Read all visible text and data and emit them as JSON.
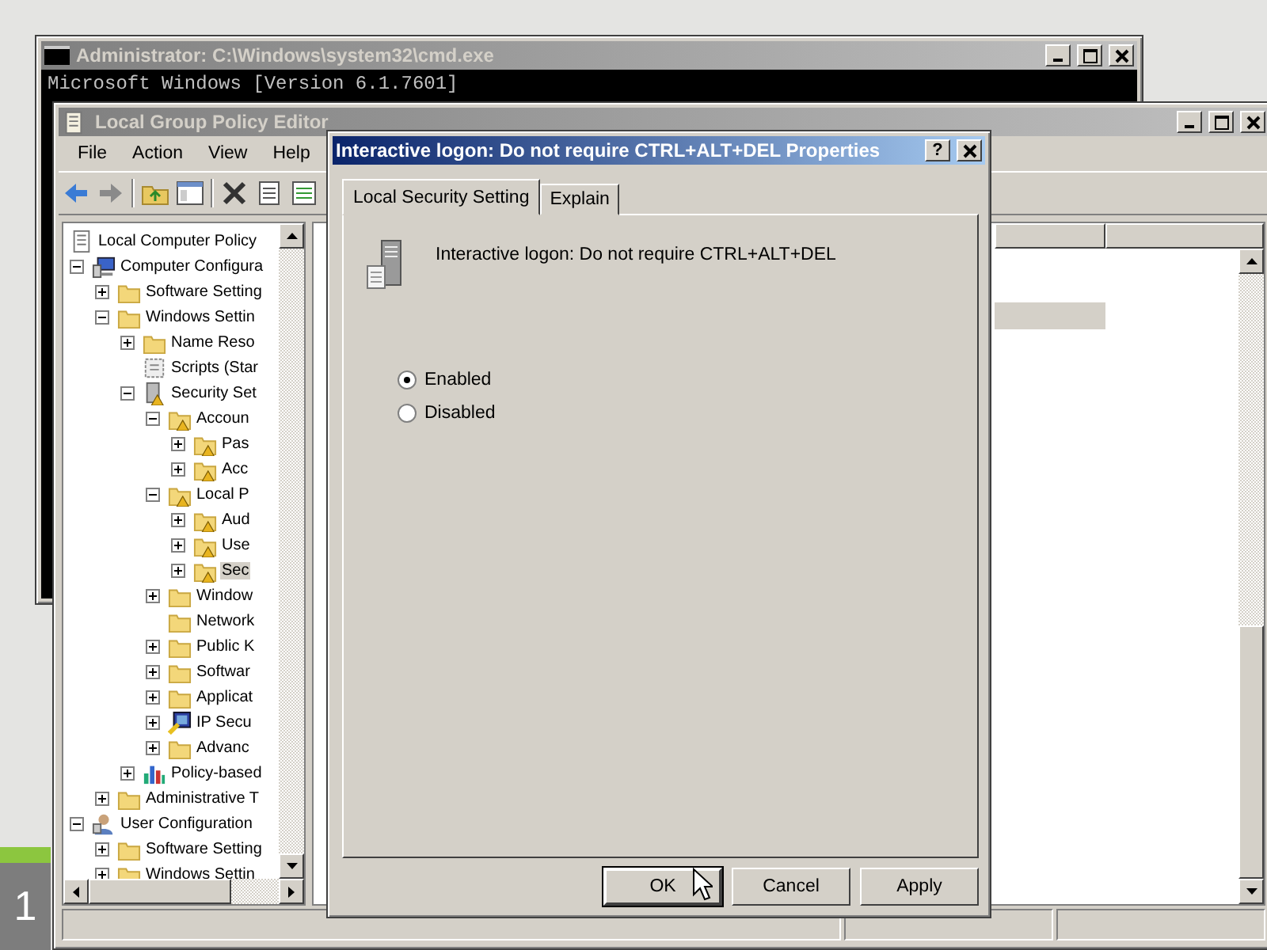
{
  "desktop": {
    "label": "1"
  },
  "console_window": {
    "title": "Administrator: C:\\Windows\\system32\\cmd.exe",
    "lines": [
      "Microsoft Windows [Version 6.1.7601]"
    ]
  },
  "editor_window": {
    "title": "Local Group Policy Editor",
    "menu": [
      "File",
      "Action",
      "View",
      "Help"
    ],
    "tree": [
      {
        "label": "Local Computer Policy",
        "kind": "policy",
        "selected": false,
        "children": [
          {
            "label": "Computer Configura",
            "kind": "computer",
            "expanded": true,
            "selected": false,
            "children": [
              {
                "label": "Software Setting",
                "kind": "folder",
                "expanded": false,
                "selected": false
              },
              {
                "label": "Windows Settin",
                "kind": "folder",
                "expanded": true,
                "selected": false,
                "children": [
                  {
                    "label": "Name Reso",
                    "kind": "folder",
                    "expanded": false,
                    "selected": false
                  },
                  {
                    "label": "Scripts (Star",
                    "kind": "script",
                    "selected": false
                  },
                  {
                    "label": "Security Set",
                    "kind": "security",
                    "expanded": true,
                    "selected": false,
                    "children": [
                      {
                        "label": "Accoun",
                        "kind": "lockfolder",
                        "expanded": true,
                        "selected": false,
                        "children": [
                          {
                            "label": "Pas",
                            "kind": "lockfolder",
                            "expanded": false,
                            "selected": false
                          },
                          {
                            "label": "Acc",
                            "kind": "lockfolder",
                            "expanded": false,
                            "selected": false
                          }
                        ]
                      },
                      {
                        "label": "Local P",
                        "kind": "lockfolder",
                        "expanded": true,
                        "selected": false,
                        "children": [
                          {
                            "label": "Aud",
                            "kind": "lockfolder",
                            "expanded": false,
                            "selected": false
                          },
                          {
                            "label": "Use",
                            "kind": "lockfolder",
                            "expanded": false,
                            "selected": false
                          },
                          {
                            "label": "Sec",
                            "kind": "lockfolder",
                            "expanded": false,
                            "selected": true
                          }
                        ]
                      },
                      {
                        "label": "Window",
                        "kind": "folder",
                        "expanded": false,
                        "selected": false
                      },
                      {
                        "label": "Network",
                        "kind": "folder",
                        "selected": false
                      },
                      {
                        "label": "Public K",
                        "kind": "folder",
                        "expanded": false,
                        "selected": false
                      },
                      {
                        "label": "Softwar",
                        "kind": "folder",
                        "expanded": false,
                        "selected": false
                      },
                      {
                        "label": "Applicat",
                        "kind": "folder",
                        "expanded": false,
                        "selected": false
                      },
                      {
                        "label": "IP Secu",
                        "kind": "ipsec",
                        "expanded": false,
                        "selected": false
                      },
                      {
                        "label": "Advanc",
                        "kind": "folder",
                        "expanded": false,
                        "selected": false
                      }
                    ]
                  },
                  {
                    "label": "Policy-based",
                    "kind": "chart",
                    "expanded": false,
                    "selected": false
                  }
                ]
              },
              {
                "label": "Administrative T",
                "kind": "folder",
                "expanded": false,
                "selected": false
              }
            ]
          },
          {
            "label": "User Configuration",
            "kind": "user",
            "expanded": true,
            "selected": false,
            "children": [
              {
                "label": "Software Setting",
                "kind": "folder",
                "expanded": false,
                "selected": false
              },
              {
                "label": "Windows Settin",
                "kind": "folder",
                "expanded": false,
                "selected": false
              }
            ]
          }
        ]
      }
    ]
  },
  "dialog": {
    "title": "Interactive logon: Do not require CTRL+ALT+DEL Properties",
    "help_button": "?",
    "tabs": [
      {
        "label": "Local Security Setting",
        "selected": true
      },
      {
        "label": "Explain",
        "selected": false
      }
    ],
    "setting_name": "Interactive logon: Do not require CTRL+ALT+DEL",
    "options": [
      {
        "label": "Enabled",
        "selected": true
      },
      {
        "label": "Disabled",
        "selected": false
      }
    ],
    "buttons": [
      {
        "label": "OK",
        "default": true
      },
      {
        "label": "Cancel",
        "default": false
      },
      {
        "label": "Apply",
        "default": false
      }
    ]
  }
}
